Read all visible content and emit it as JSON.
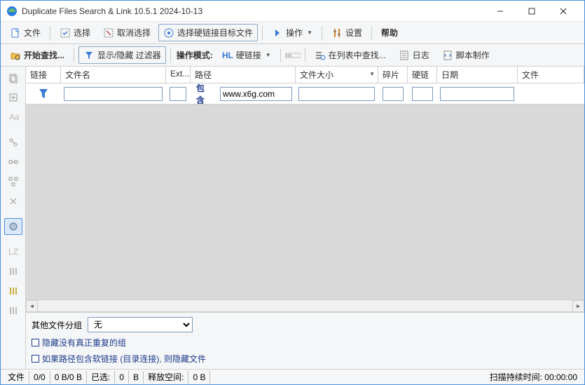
{
  "title": "Duplicate Files Search & Link 10.5.1 2024-10-13",
  "menubar": {
    "file": "文件",
    "select": "选择",
    "deselect": "取消选择",
    "select_hardlink_target": "选择硬链接目标文件",
    "operate": "操作",
    "settings": "设置",
    "help": "帮助"
  },
  "toolbar2": {
    "start_search": "开始查找...",
    "show_hide_filter": "显示/隐藏 过滤器",
    "mode_label": "操作模式:",
    "hardlink": "硬链接",
    "search_in_list": "在列表中查找...",
    "log": "日志",
    "script": "脚本制作"
  },
  "columns": {
    "link": "链接",
    "name": "文件名",
    "ext": "Ext...",
    "path": "路径",
    "size": "文件大小",
    "frag": "碎片",
    "hard": "硬链",
    "date": "日期",
    "file": "文件"
  },
  "filter": {
    "contains_label": "包含",
    "path_value": "www.x6g.com"
  },
  "bottom": {
    "group_label": "其他文件分组",
    "group_value": "无",
    "hide_no_dup": "隐藏没有真正重复的组",
    "hide_softlink_path": "如果路径包含软链接 (目录连接), 则隐藏文件"
  },
  "status": {
    "file_label": "文件",
    "counts": "0/0",
    "bytes": "0 B/0 B",
    "selected_label": "已选:",
    "selected": "0",
    "b1": "B",
    "free_label": "释放空间:",
    "free": "0 B",
    "scan_label": "扫描持续时间:",
    "scan_time": "00:00:00"
  }
}
